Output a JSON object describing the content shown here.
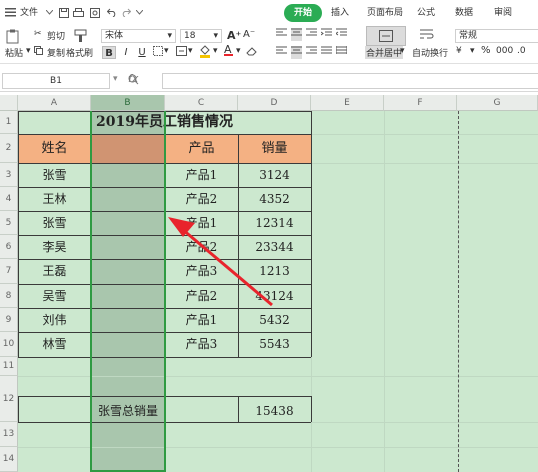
{
  "menu": {
    "file": "文件",
    "tabs": [
      "开始",
      "插入",
      "页面布局",
      "公式",
      "数据",
      "审阅"
    ],
    "active_tab": "开始"
  },
  "toolbar": {
    "paste": "粘贴",
    "cut": "剪切",
    "copy": "复制",
    "format_painter": "格式刷",
    "font_name": "宋体",
    "font_size": "18",
    "bold": "B",
    "italic": "I",
    "underline": "U",
    "merge_center": "合并居中",
    "wrap_text": "自动换行",
    "number_format": "常规",
    "percent": "%"
  },
  "formula": {
    "cell_ref": "B1",
    "fx": "fx"
  },
  "columns": [
    "A",
    "B",
    "C",
    "D",
    "E",
    "F",
    "G"
  ],
  "rows": [
    "1",
    "2",
    "3",
    "4",
    "5",
    "6",
    "7",
    "8",
    "9",
    "10",
    "11",
    "12",
    "13",
    "14"
  ],
  "sheet": {
    "title": "2019年员工销售情况",
    "headers": {
      "name": "姓名",
      "product": "产品",
      "sales": "销量"
    },
    "data": [
      {
        "name": "张雪",
        "product": "产品1",
        "sales": "3124"
      },
      {
        "name": "王林",
        "product": "产品2",
        "sales": "4352"
      },
      {
        "name": "张雪",
        "product": "产品1",
        "sales": "12314"
      },
      {
        "name": "李昊",
        "product": "产品2",
        "sales": "23344"
      },
      {
        "name": "王磊",
        "product": "产品3",
        "sales": "1213"
      },
      {
        "name": "吴雪",
        "product": "产品2",
        "sales": "43124"
      },
      {
        "name": "刘伟",
        "product": "产品1",
        "sales": "5432"
      },
      {
        "name": "林雪",
        "product": "产品3",
        "sales": "5543"
      }
    ],
    "summary_label": "张雪总销量",
    "summary_value": "15438"
  },
  "colors": {
    "accent": "#2bac54",
    "header_fill": "#f4b183",
    "arrow": "#e8242c",
    "grid_bg": "#cce8cf"
  }
}
